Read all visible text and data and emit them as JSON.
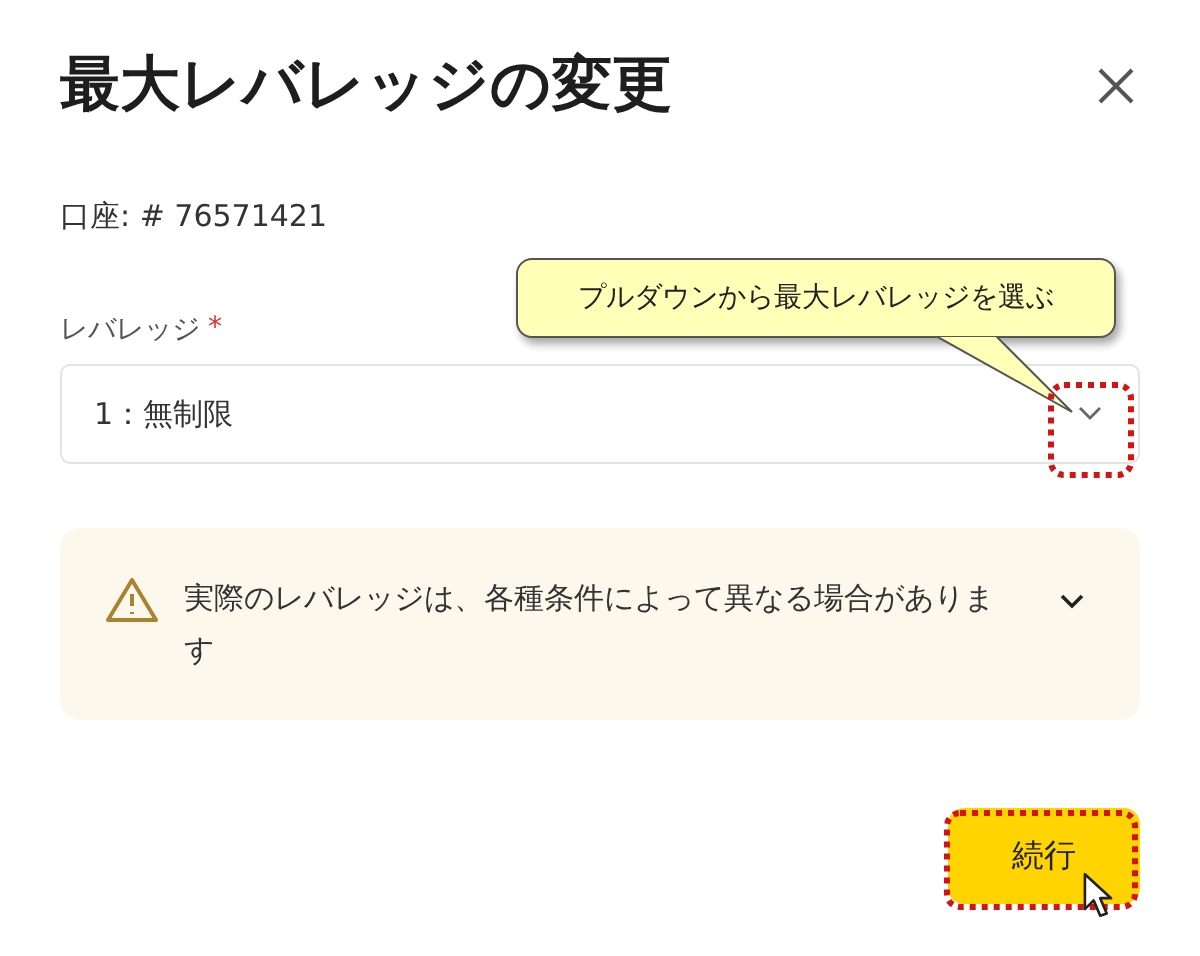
{
  "dialog": {
    "title": "最大レバレッジの変更",
    "account": "口座: # 76571421",
    "leverage_field": {
      "label": "レバレッジ",
      "required_mark": "*",
      "value": "1：無制限"
    },
    "warning": {
      "text": "実際のレバレッジは、各種条件によって異なる場合があります"
    },
    "buttons": [
      {
        "label": "続行"
      }
    ]
  },
  "annotation": {
    "callout": "プルダウンから最大レバレッジを選ぶ"
  }
}
